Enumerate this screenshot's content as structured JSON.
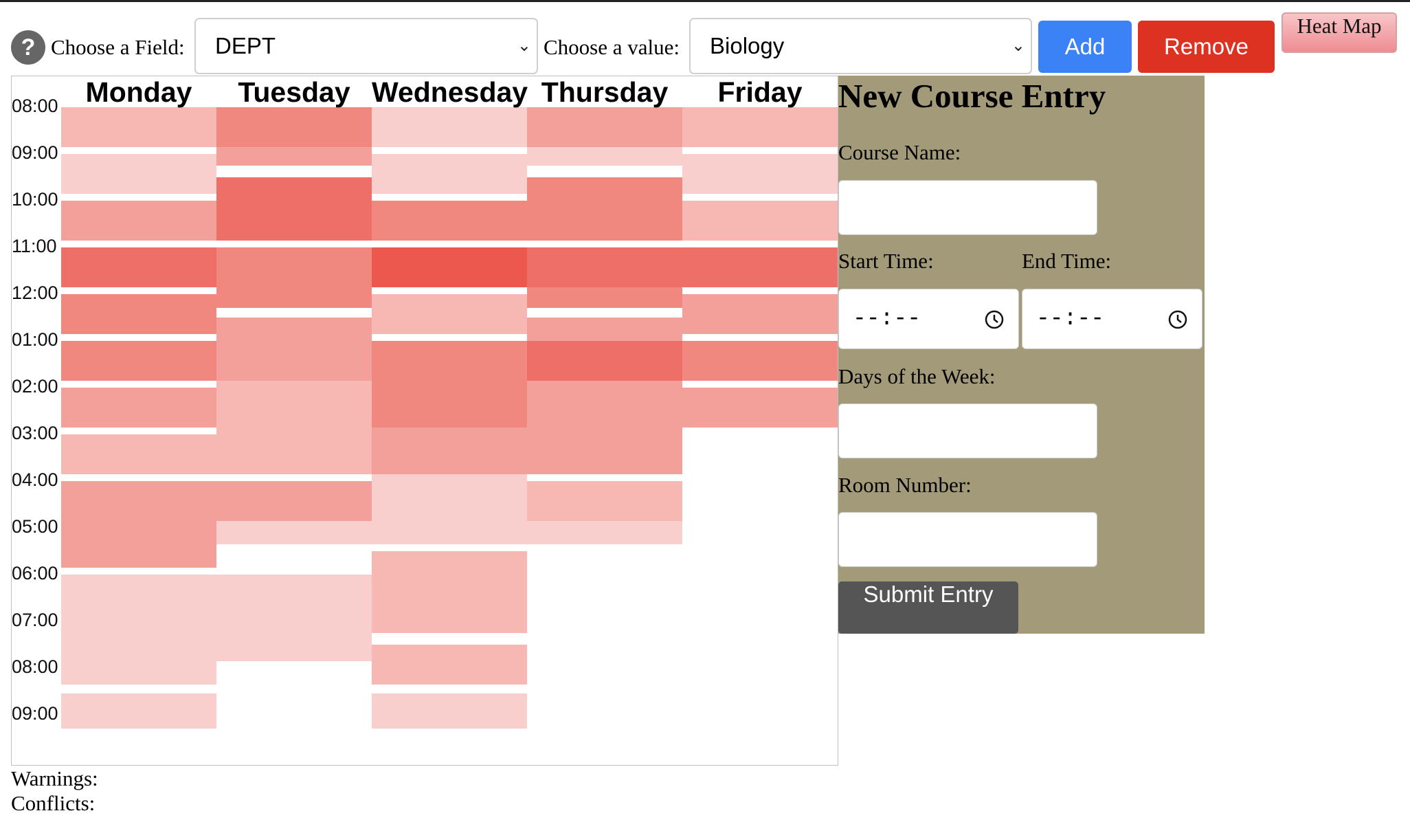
{
  "toolbar": {
    "help_label": "?",
    "field_label": "Choose a Field:",
    "field_value": "DEPT",
    "value_label": "Choose a value:",
    "value_value": "Biology",
    "add_label": "Add",
    "remove_label": "Remove",
    "heatmap_label": "Heat Map",
    "colors": {
      "add": "#3b82f6",
      "remove": "#dd3222",
      "help": "#666666"
    }
  },
  "schedule": {
    "days": [
      "Monday",
      "Tuesday",
      "Wednesday",
      "Thursday",
      "Friday"
    ],
    "hours": [
      "08:00",
      "09:00",
      "10:00",
      "11:00",
      "12:00",
      "01:00",
      "02:00",
      "03:00",
      "04:00",
      "05:00",
      "06:00",
      "07:00",
      "08:00",
      "09:00"
    ],
    "first_hour": 8,
    "heat_color": "#e8382c",
    "heat_blocks": [
      [
        {
          "s": 8.0,
          "e": 8.85,
          "n": 2
        },
        {
          "s": 9.0,
          "e": 9.85,
          "n": 1
        },
        {
          "s": 10.0,
          "e": 10.85,
          "n": 3
        },
        {
          "s": 11.0,
          "e": 11.85,
          "n": 5
        },
        {
          "s": 12.0,
          "e": 12.85,
          "n": 4
        },
        {
          "s": 13.0,
          "e": 13.85,
          "n": 4
        },
        {
          "s": 14.0,
          "e": 14.85,
          "n": 3
        },
        {
          "s": 15.0,
          "e": 15.85,
          "n": 2
        },
        {
          "s": 16.0,
          "e": 17.85,
          "n": 3
        },
        {
          "s": 18.0,
          "e": 19.25,
          "n": 1
        },
        {
          "s": 19.25,
          "e": 20.35,
          "n": 1
        },
        {
          "s": 20.55,
          "e": 21.3,
          "n": 1
        }
      ],
      [
        {
          "s": 8.0,
          "e": 8.85,
          "n": 4
        },
        {
          "s": 8.85,
          "e": 9.25,
          "n": 3
        },
        {
          "s": 9.5,
          "e": 10.85,
          "n": 5
        },
        {
          "s": 11.0,
          "e": 12.3,
          "n": 4
        },
        {
          "s": 12.5,
          "e": 13.85,
          "n": 3
        },
        {
          "s": 13.85,
          "e": 14.85,
          "n": 2
        },
        {
          "s": 14.85,
          "e": 15.85,
          "n": 2
        },
        {
          "s": 16.0,
          "e": 16.85,
          "n": 3
        },
        {
          "s": 16.85,
          "e": 17.35,
          "n": 1
        },
        {
          "s": 18.0,
          "e": 19.85,
          "n": 1
        }
      ],
      [
        {
          "s": 8.0,
          "e": 8.85,
          "n": 1
        },
        {
          "s": 9.0,
          "e": 9.85,
          "n": 1
        },
        {
          "s": 10.0,
          "e": 10.85,
          "n": 4
        },
        {
          "s": 11.0,
          "e": 11.85,
          "n": 6
        },
        {
          "s": 12.0,
          "e": 12.85,
          "n": 2
        },
        {
          "s": 13.0,
          "e": 13.85,
          "n": 4
        },
        {
          "s": 13.85,
          "e": 14.85,
          "n": 4
        },
        {
          "s": 14.85,
          "e": 15.85,
          "n": 3
        },
        {
          "s": 15.85,
          "e": 16.35,
          "n": 1
        },
        {
          "s": 16.35,
          "e": 17.35,
          "n": 1
        },
        {
          "s": 17.5,
          "e": 19.25,
          "n": 2
        },
        {
          "s": 19.5,
          "e": 20.35,
          "n": 2
        },
        {
          "s": 20.55,
          "e": 21.3,
          "n": 1
        }
      ],
      [
        {
          "s": 8.0,
          "e": 8.85,
          "n": 3
        },
        {
          "s": 8.85,
          "e": 9.25,
          "n": 1
        },
        {
          "s": 9.5,
          "e": 10.85,
          "n": 4
        },
        {
          "s": 11.0,
          "e": 11.85,
          "n": 5
        },
        {
          "s": 11.85,
          "e": 12.3,
          "n": 4
        },
        {
          "s": 12.5,
          "e": 13.0,
          "n": 3
        },
        {
          "s": 13.0,
          "e": 13.85,
          "n": 5
        },
        {
          "s": 13.85,
          "e": 14.85,
          "n": 3
        },
        {
          "s": 14.85,
          "e": 15.85,
          "n": 3
        },
        {
          "s": 16.0,
          "e": 16.85,
          "n": 2
        },
        {
          "s": 16.85,
          "e": 17.35,
          "n": 1
        }
      ],
      [
        {
          "s": 8.0,
          "e": 8.85,
          "n": 2
        },
        {
          "s": 9.0,
          "e": 9.85,
          "n": 1
        },
        {
          "s": 10.0,
          "e": 10.85,
          "n": 2
        },
        {
          "s": 11.0,
          "e": 11.85,
          "n": 5
        },
        {
          "s": 12.0,
          "e": 12.85,
          "n": 3
        },
        {
          "s": 13.0,
          "e": 13.85,
          "n": 4
        },
        {
          "s": 14.0,
          "e": 14.85,
          "n": 3
        }
      ]
    ]
  },
  "form": {
    "title": "New Course Entry",
    "course_name_label": "Course Name:",
    "start_time_label": "Start Time:",
    "end_time_label": "End Time:",
    "time_placeholder": "--:--",
    "days_label": "Days of the Week:",
    "room_label": "Room Number:",
    "submit_label": "Submit Entry",
    "panel_color": "#a39a79"
  },
  "footer": {
    "warnings_label": "Warnings:",
    "conflicts_label": "Conflicts:"
  }
}
